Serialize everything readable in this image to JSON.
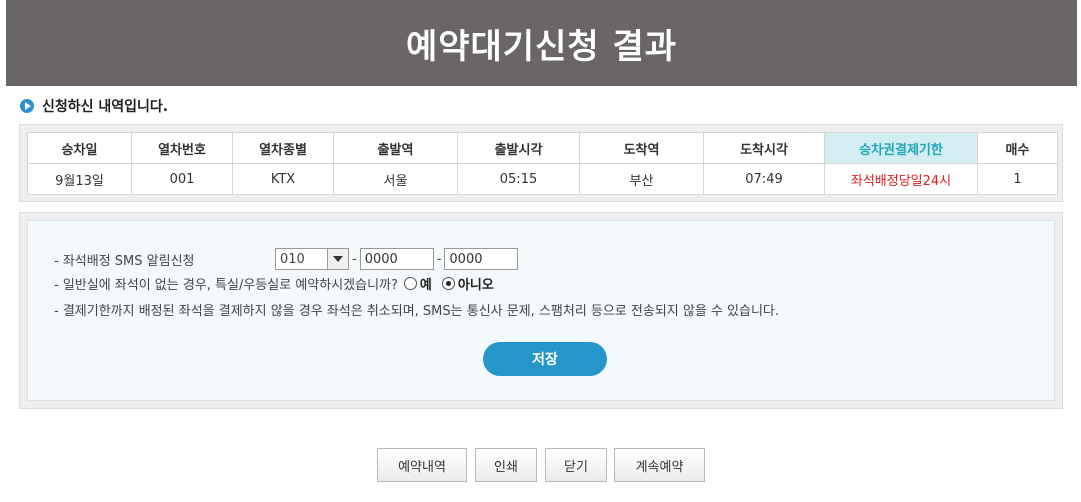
{
  "title": "예약대기신청 결과",
  "section_heading": "신청하신 내역입니다.",
  "table": {
    "headers": [
      "승차일",
      "열차번호",
      "열차종별",
      "출발역",
      "출발시각",
      "도착역",
      "도착시각",
      "승차권결제기한",
      "매수"
    ],
    "rows": [
      [
        "9월13일",
        "001",
        "KTX",
        "서울",
        "05:15",
        "부산",
        "07:49",
        "좌석배정당일24시",
        "1"
      ]
    ]
  },
  "form": {
    "sms_label": "- 좌석배정 SMS 알림신청",
    "phone_prefix": "010",
    "phone_mid": "0000",
    "phone_last": "0000",
    "dash": "-",
    "special_question": "- 일반실에 좌석이 없는 경우, 특실/우등실로 예약하시겠습니까?",
    "yes_label": "예",
    "no_label": "아니오",
    "selected": "no",
    "notice": "- 결제기한까지 배정된 좌석을 결제하지 않을 경우 좌석은 취소되며, SMS는 통신사 문제, 스팸처리 등으로 전송되지 않을 수 있습니다.",
    "save_label": "저장"
  },
  "buttons": {
    "history": "예약내역",
    "print": "인쇄",
    "close": "닫기",
    "continue": "계속예약"
  },
  "colors": {
    "title_bg": "#6b6666",
    "accent_blue": "#2596c9",
    "deadline_header_bg": "#d2eef3",
    "deadline_text": "#e02020"
  }
}
